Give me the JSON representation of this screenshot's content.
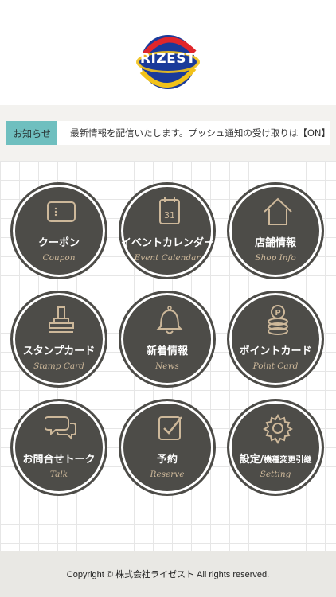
{
  "header": {
    "logo_text": "RIZEST"
  },
  "notice": {
    "label": "お知らせ",
    "text": "最新情報を配信いたします。プッシュ通知の受け取りは【ON】で"
  },
  "menu": [
    {
      "label": "クーポン",
      "sub": "Coupon",
      "icon": "coupon-icon"
    },
    {
      "label": "イベントカレンダー",
      "sub": "Event Calendar",
      "icon": "calendar-icon",
      "calendar_day": "31"
    },
    {
      "label": "店舗情報",
      "sub": "Shop Info",
      "icon": "home-icon"
    },
    {
      "label": "スタンプカード",
      "sub": "Stamp Card",
      "icon": "stamp-icon"
    },
    {
      "label": "新着情報",
      "sub": "News",
      "icon": "bell-icon"
    },
    {
      "label": "ポイントカード",
      "sub": "Point Card",
      "icon": "coins-icon",
      "coin_letter": "P"
    },
    {
      "label": "お問合せトーク",
      "sub": "Talk",
      "icon": "chat-bubbles-icon"
    },
    {
      "label": "予約",
      "sub": "Reserve",
      "icon": "checkbox-icon"
    },
    {
      "label": "設定/",
      "label_small": "機種変更引継",
      "sub": "Setting",
      "icon": "gear-icon"
    }
  ],
  "footer": {
    "copyright": "Copyright © 株式会社ライゼスト All rights reserved."
  },
  "colors": {
    "tile_bg": "#4d4c48",
    "tile_accent": "#cdb89a",
    "notice_label_bg": "#6fbfbf"
  }
}
